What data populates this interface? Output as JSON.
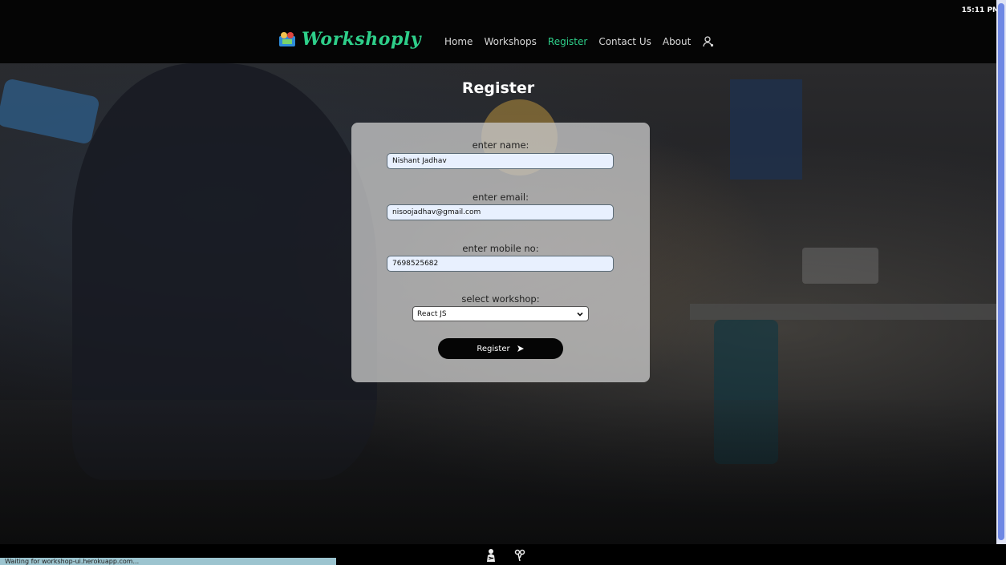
{
  "system": {
    "time": "15:11 PM"
  },
  "brand": {
    "name": "Workshoply",
    "color": "#2ecf8a"
  },
  "nav": {
    "items": [
      {
        "label": "Home",
        "active": false
      },
      {
        "label": "Workshops",
        "active": false
      },
      {
        "label": "Register",
        "active": true
      },
      {
        "label": "Contact Us",
        "active": false
      },
      {
        "label": "About",
        "active": false
      }
    ],
    "user_icon": "user-icon"
  },
  "page": {
    "title": "Register"
  },
  "form": {
    "name_label": "enter name:",
    "name_value": "Nishant Jadhav",
    "email_label": "enter email:",
    "email_value": "nisoojadhav@gmail.com",
    "mobile_label": "enter mobile no:",
    "mobile_value": "7698525682",
    "workshop_label": "select workshop:",
    "workshop_selected": "React JS",
    "submit_label": "Register"
  },
  "footer": {
    "icons": [
      "user-silhouette-icon",
      "scissors-icon"
    ]
  },
  "status": {
    "text": "Waiting for workshop-ui.herokuapp.com..."
  },
  "colors": {
    "accent": "#2ecf8a",
    "card": "#c8c8c8",
    "input_fill": "#e8f0fe",
    "scrollbar": "#6f88e4"
  }
}
